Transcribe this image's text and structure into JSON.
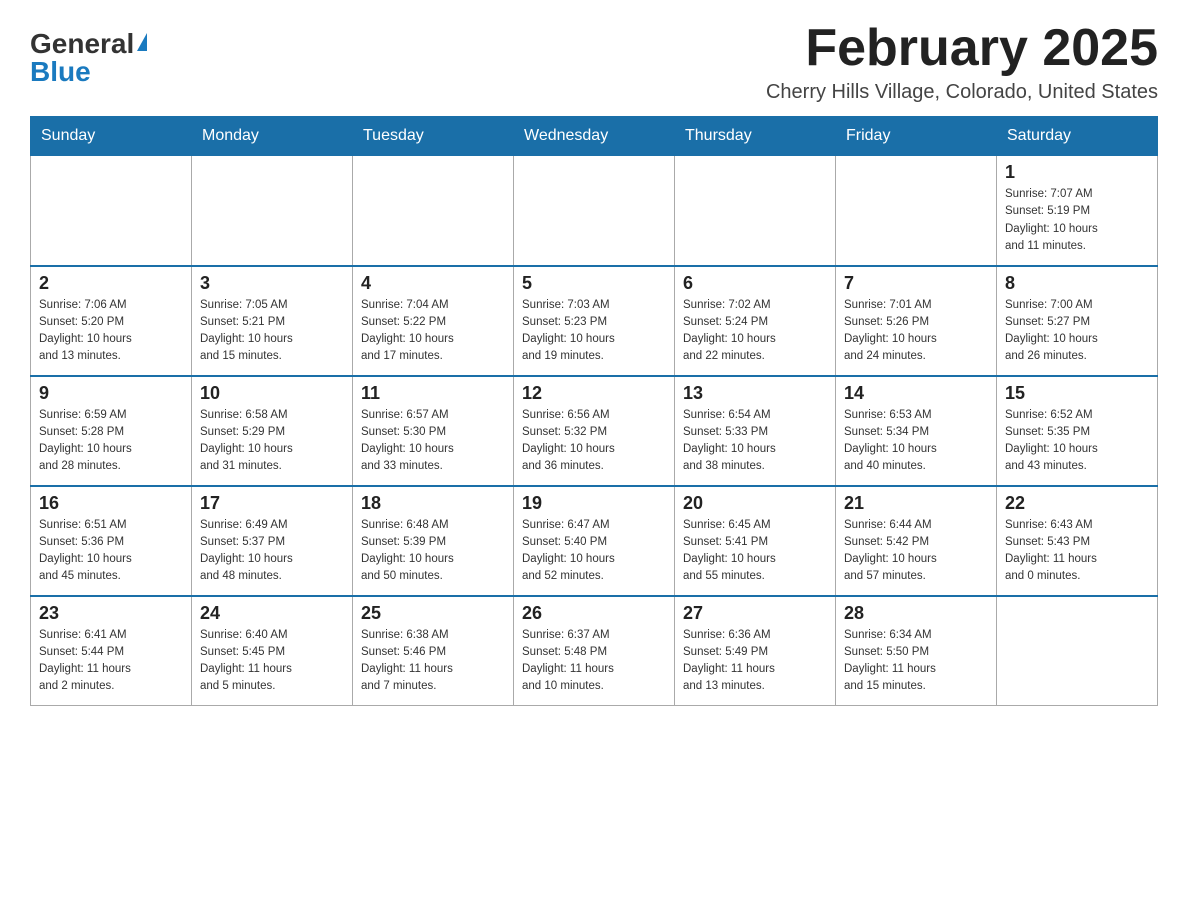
{
  "logo": {
    "general": "General",
    "blue": "Blue"
  },
  "title": "February 2025",
  "location": "Cherry Hills Village, Colorado, United States",
  "weekdays": [
    "Sunday",
    "Monday",
    "Tuesday",
    "Wednesday",
    "Thursday",
    "Friday",
    "Saturday"
  ],
  "weeks": [
    [
      {
        "day": "",
        "info": ""
      },
      {
        "day": "",
        "info": ""
      },
      {
        "day": "",
        "info": ""
      },
      {
        "day": "",
        "info": ""
      },
      {
        "day": "",
        "info": ""
      },
      {
        "day": "",
        "info": ""
      },
      {
        "day": "1",
        "info": "Sunrise: 7:07 AM\nSunset: 5:19 PM\nDaylight: 10 hours\nand 11 minutes."
      }
    ],
    [
      {
        "day": "2",
        "info": "Sunrise: 7:06 AM\nSunset: 5:20 PM\nDaylight: 10 hours\nand 13 minutes."
      },
      {
        "day": "3",
        "info": "Sunrise: 7:05 AM\nSunset: 5:21 PM\nDaylight: 10 hours\nand 15 minutes."
      },
      {
        "day": "4",
        "info": "Sunrise: 7:04 AM\nSunset: 5:22 PM\nDaylight: 10 hours\nand 17 minutes."
      },
      {
        "day": "5",
        "info": "Sunrise: 7:03 AM\nSunset: 5:23 PM\nDaylight: 10 hours\nand 19 minutes."
      },
      {
        "day": "6",
        "info": "Sunrise: 7:02 AM\nSunset: 5:24 PM\nDaylight: 10 hours\nand 22 minutes."
      },
      {
        "day": "7",
        "info": "Sunrise: 7:01 AM\nSunset: 5:26 PM\nDaylight: 10 hours\nand 24 minutes."
      },
      {
        "day": "8",
        "info": "Sunrise: 7:00 AM\nSunset: 5:27 PM\nDaylight: 10 hours\nand 26 minutes."
      }
    ],
    [
      {
        "day": "9",
        "info": "Sunrise: 6:59 AM\nSunset: 5:28 PM\nDaylight: 10 hours\nand 28 minutes."
      },
      {
        "day": "10",
        "info": "Sunrise: 6:58 AM\nSunset: 5:29 PM\nDaylight: 10 hours\nand 31 minutes."
      },
      {
        "day": "11",
        "info": "Sunrise: 6:57 AM\nSunset: 5:30 PM\nDaylight: 10 hours\nand 33 minutes."
      },
      {
        "day": "12",
        "info": "Sunrise: 6:56 AM\nSunset: 5:32 PM\nDaylight: 10 hours\nand 36 minutes."
      },
      {
        "day": "13",
        "info": "Sunrise: 6:54 AM\nSunset: 5:33 PM\nDaylight: 10 hours\nand 38 minutes."
      },
      {
        "day": "14",
        "info": "Sunrise: 6:53 AM\nSunset: 5:34 PM\nDaylight: 10 hours\nand 40 minutes."
      },
      {
        "day": "15",
        "info": "Sunrise: 6:52 AM\nSunset: 5:35 PM\nDaylight: 10 hours\nand 43 minutes."
      }
    ],
    [
      {
        "day": "16",
        "info": "Sunrise: 6:51 AM\nSunset: 5:36 PM\nDaylight: 10 hours\nand 45 minutes."
      },
      {
        "day": "17",
        "info": "Sunrise: 6:49 AM\nSunset: 5:37 PM\nDaylight: 10 hours\nand 48 minutes."
      },
      {
        "day": "18",
        "info": "Sunrise: 6:48 AM\nSunset: 5:39 PM\nDaylight: 10 hours\nand 50 minutes."
      },
      {
        "day": "19",
        "info": "Sunrise: 6:47 AM\nSunset: 5:40 PM\nDaylight: 10 hours\nand 52 minutes."
      },
      {
        "day": "20",
        "info": "Sunrise: 6:45 AM\nSunset: 5:41 PM\nDaylight: 10 hours\nand 55 minutes."
      },
      {
        "day": "21",
        "info": "Sunrise: 6:44 AM\nSunset: 5:42 PM\nDaylight: 10 hours\nand 57 minutes."
      },
      {
        "day": "22",
        "info": "Sunrise: 6:43 AM\nSunset: 5:43 PM\nDaylight: 11 hours\nand 0 minutes."
      }
    ],
    [
      {
        "day": "23",
        "info": "Sunrise: 6:41 AM\nSunset: 5:44 PM\nDaylight: 11 hours\nand 2 minutes."
      },
      {
        "day": "24",
        "info": "Sunrise: 6:40 AM\nSunset: 5:45 PM\nDaylight: 11 hours\nand 5 minutes."
      },
      {
        "day": "25",
        "info": "Sunrise: 6:38 AM\nSunset: 5:46 PM\nDaylight: 11 hours\nand 7 minutes."
      },
      {
        "day": "26",
        "info": "Sunrise: 6:37 AM\nSunset: 5:48 PM\nDaylight: 11 hours\nand 10 minutes."
      },
      {
        "day": "27",
        "info": "Sunrise: 6:36 AM\nSunset: 5:49 PM\nDaylight: 11 hours\nand 13 minutes."
      },
      {
        "day": "28",
        "info": "Sunrise: 6:34 AM\nSunset: 5:50 PM\nDaylight: 11 hours\nand 15 minutes."
      },
      {
        "day": "",
        "info": ""
      }
    ]
  ]
}
